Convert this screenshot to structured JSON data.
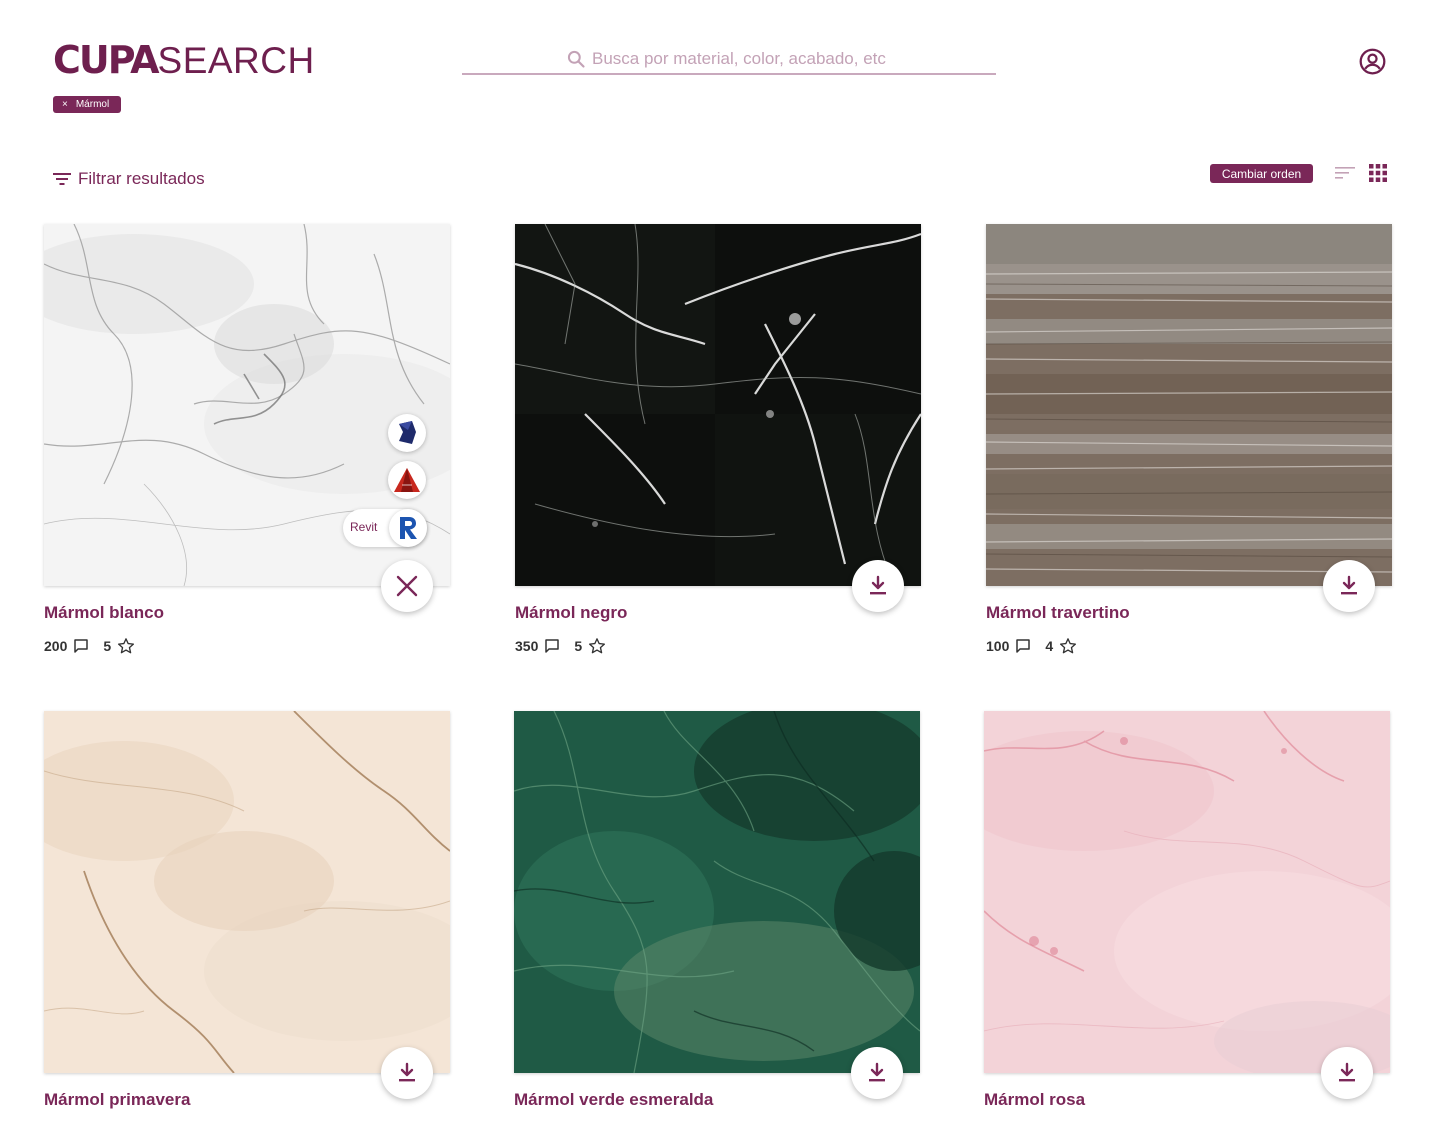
{
  "app": {
    "logo_primary": "CUPA",
    "logo_secondary": "SEARCH"
  },
  "search": {
    "placeholder": "Busca por material, color, acabado, etc",
    "value": ""
  },
  "active_filters": [
    {
      "label": "Mármol",
      "remove_symbol": "×"
    }
  ],
  "toolbar": {
    "filter_label": "Filtrar resultados",
    "sort_label": "Cambiar orden",
    "view": "grid"
  },
  "colors": {
    "brand": "#7a2758",
    "placeholder": "#c3a2b6"
  },
  "results": [
    {
      "title": "Mármol blanco",
      "comments": "200",
      "rating": "5",
      "texture": "white-marble",
      "action_icon": "close-icon",
      "expanded": true
    },
    {
      "title": "Mármol negro",
      "comments": "350",
      "rating": "5",
      "texture": "black-marble",
      "action_icon": "download-icon"
    },
    {
      "title": "Mármol travertino",
      "comments": "100",
      "rating": "4",
      "texture": "travertine",
      "action_icon": "download-icon"
    },
    {
      "title": "Mármol primavera",
      "texture": "beige-marble",
      "action_icon": "download-icon"
    },
    {
      "title": "Mármol verde esmeralda",
      "texture": "green-marble",
      "action_icon": "download-icon"
    },
    {
      "title": "Mármol rosa",
      "texture": "pink-marble",
      "action_icon": "download-icon"
    }
  ],
  "download_menu": {
    "items": [
      {
        "icon": "sketchup-icon"
      },
      {
        "icon": "autocad-icon"
      },
      {
        "icon": "revit-icon",
        "label": "Revit"
      }
    ]
  }
}
